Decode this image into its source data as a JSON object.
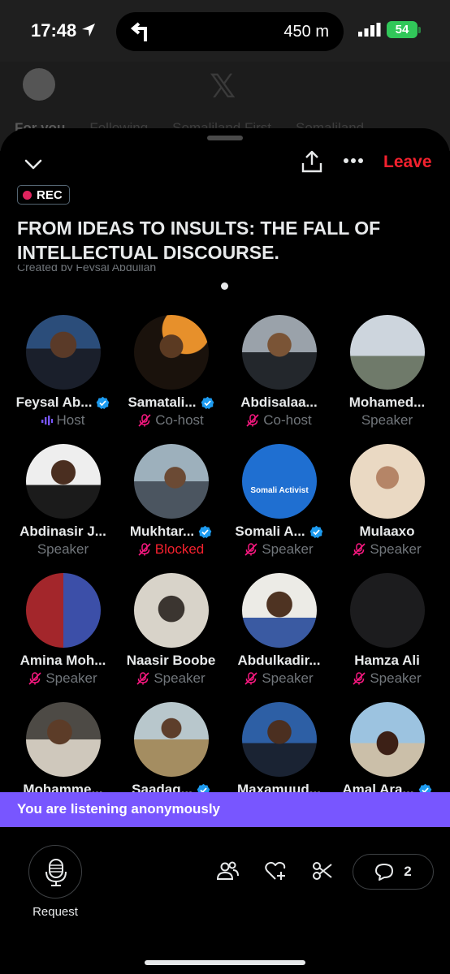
{
  "status_bar": {
    "time": "17:48",
    "nav_distance": "450 m",
    "battery": "54"
  },
  "background_app": {
    "tabs": [
      "For you",
      "Following",
      "Somaliland First",
      "Somaliland"
    ]
  },
  "space": {
    "rec_label": "REC",
    "title": "FROM IDEAS TO INSULTS: THE FALL OF INTELLECTUAL DISCOURSE.",
    "cohost_line": "Created by Feysal Abdullah",
    "leave_label": "Leave"
  },
  "participants": [
    {
      "name": "Feysal Ab...",
      "role": "Host",
      "verified": true,
      "role_icon": "host-bars-icon",
      "avatar": "feysal"
    },
    {
      "name": "Samatali...",
      "role": "Co-host",
      "verified": true,
      "role_icon": "mic-off-icon",
      "avatar": "samatali"
    },
    {
      "name": "Abdisalaa...",
      "role": "Co-host",
      "verified": false,
      "role_icon": "mic-off-icon",
      "avatar": "abdisalaam"
    },
    {
      "name": "Mohamed...",
      "role": "Speaker",
      "verified": false,
      "role_icon": "",
      "avatar": "mohamed"
    },
    {
      "name": "Abdinasir J...",
      "role": "Speaker",
      "verified": false,
      "role_icon": "",
      "avatar": "abdinasir"
    },
    {
      "name": "Mukhtar...",
      "role": "Blocked",
      "verified": true,
      "role_icon": "mic-off-icon",
      "avatar": "mukhtar"
    },
    {
      "name": "Somali A...",
      "role": "Speaker",
      "verified": true,
      "role_icon": "mic-off-icon",
      "avatar": "somali",
      "avatar_text": "Somali Activist"
    },
    {
      "name": "Mulaaxo",
      "role": "Speaker",
      "verified": false,
      "role_icon": "mic-off-icon",
      "avatar": "mulaaxo"
    },
    {
      "name": "Amina Moh...",
      "role": "Speaker",
      "verified": false,
      "role_icon": "mic-off-icon",
      "avatar": "amina"
    },
    {
      "name": "Naasir Boobe",
      "role": "Speaker",
      "verified": false,
      "role_icon": "mic-off-icon",
      "avatar": "naasir"
    },
    {
      "name": "Abdulkadir...",
      "role": "Speaker",
      "verified": false,
      "role_icon": "mic-off-icon",
      "avatar": "abdulkadir"
    },
    {
      "name": "Hamza Ali",
      "role": "Speaker",
      "verified": false,
      "role_icon": "mic-off-icon",
      "avatar": "hamza"
    },
    {
      "name": "Mohamme...",
      "role": "",
      "verified": false,
      "role_icon": "",
      "avatar": "mohammed2"
    },
    {
      "name": "Saadaq...",
      "role": "",
      "verified": true,
      "role_icon": "",
      "avatar": "saadaq"
    },
    {
      "name": "Maxamuud...",
      "role": "",
      "verified": false,
      "role_icon": "",
      "avatar": "maxamuud"
    },
    {
      "name": "Amal Ara...",
      "role": "",
      "verified": true,
      "role_icon": "",
      "avatar": "amal"
    }
  ],
  "banner": {
    "text": "You are listening anonymously"
  },
  "bottom_bar": {
    "request_label": "Request",
    "comment_count": "2"
  },
  "colors": {
    "accent_red": "#f4212e",
    "banner_purple": "#7856ff",
    "verified_blue": "#1d9bf0",
    "mic_off_pink": "#f91880"
  }
}
